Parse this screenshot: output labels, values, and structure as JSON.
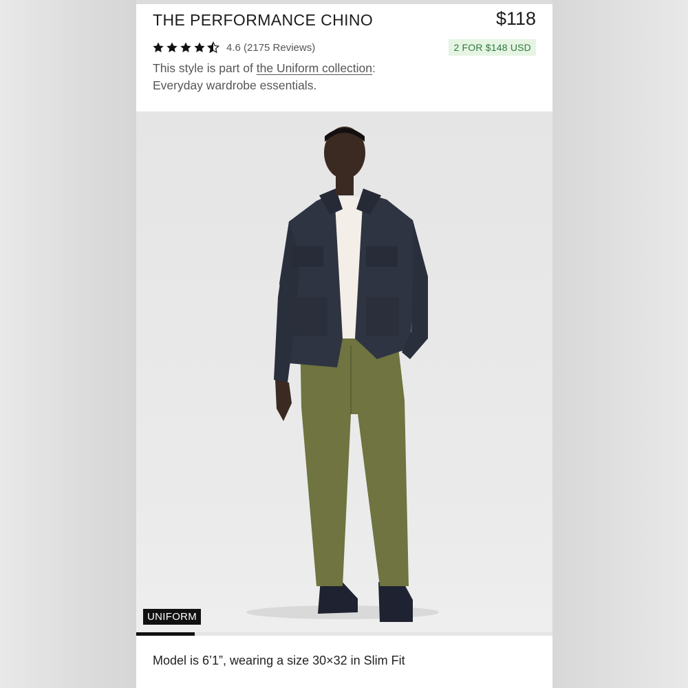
{
  "product": {
    "title": "THE PERFORMANCE CHINO",
    "price": "$118",
    "rating_value": 4.6,
    "rating_text": "4.6 (2175 Reviews)",
    "promo": "2 FOR $148 USD",
    "desc_prefix": "This style is part of ",
    "desc_link": "the Uniform collection",
    "desc_suffix": ":",
    "desc_line2": "Everyday wardrobe essentials."
  },
  "gallery": {
    "badge": "UNIFORM",
    "progress_fraction": 0.14,
    "caption": "Model is 6’1”, wearing a size 30×32 in Slim Fit"
  },
  "colors": {
    "promo_bg": "#e6f4e4",
    "promo_text": "#2f7a3b",
    "jacket": "#2f3442",
    "pants": "#6f7440",
    "tee": "#f3efe8",
    "skin": "#3a2a22"
  },
  "icons": {
    "star": "star-icon",
    "half_star": "star-half-icon"
  }
}
